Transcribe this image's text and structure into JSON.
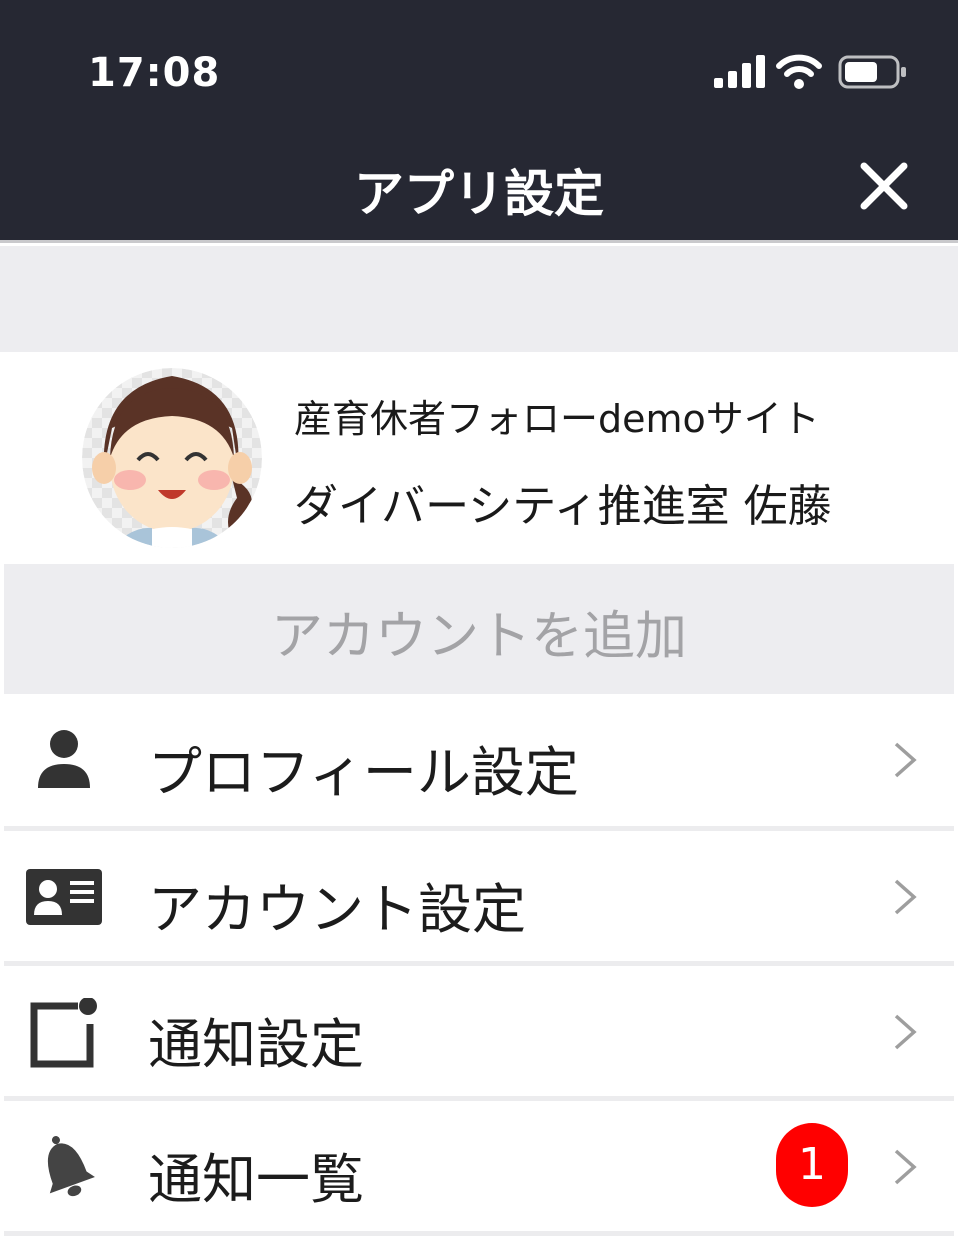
{
  "status_bar": {
    "time": "17:08"
  },
  "nav": {
    "title": "アプリ設定"
  },
  "profile": {
    "site_name": "産育休者フォローdemoサイト",
    "user_name": "ダイバーシティ推進室 佐藤"
  },
  "add_account_label": "アカウントを追加",
  "menu": {
    "items": [
      {
        "label": "プロフィール設定",
        "icon": "person-icon"
      },
      {
        "label": "アカウント設定",
        "icon": "id-card-icon"
      },
      {
        "label": "通知設定",
        "icon": "notification-settings-icon"
      },
      {
        "label": "通知一覧",
        "icon": "bell-icon",
        "badge": "1"
      }
    ]
  },
  "colors": {
    "header_bg": "#262833",
    "section_bg": "#ededf0",
    "badge": "#ff0000"
  }
}
